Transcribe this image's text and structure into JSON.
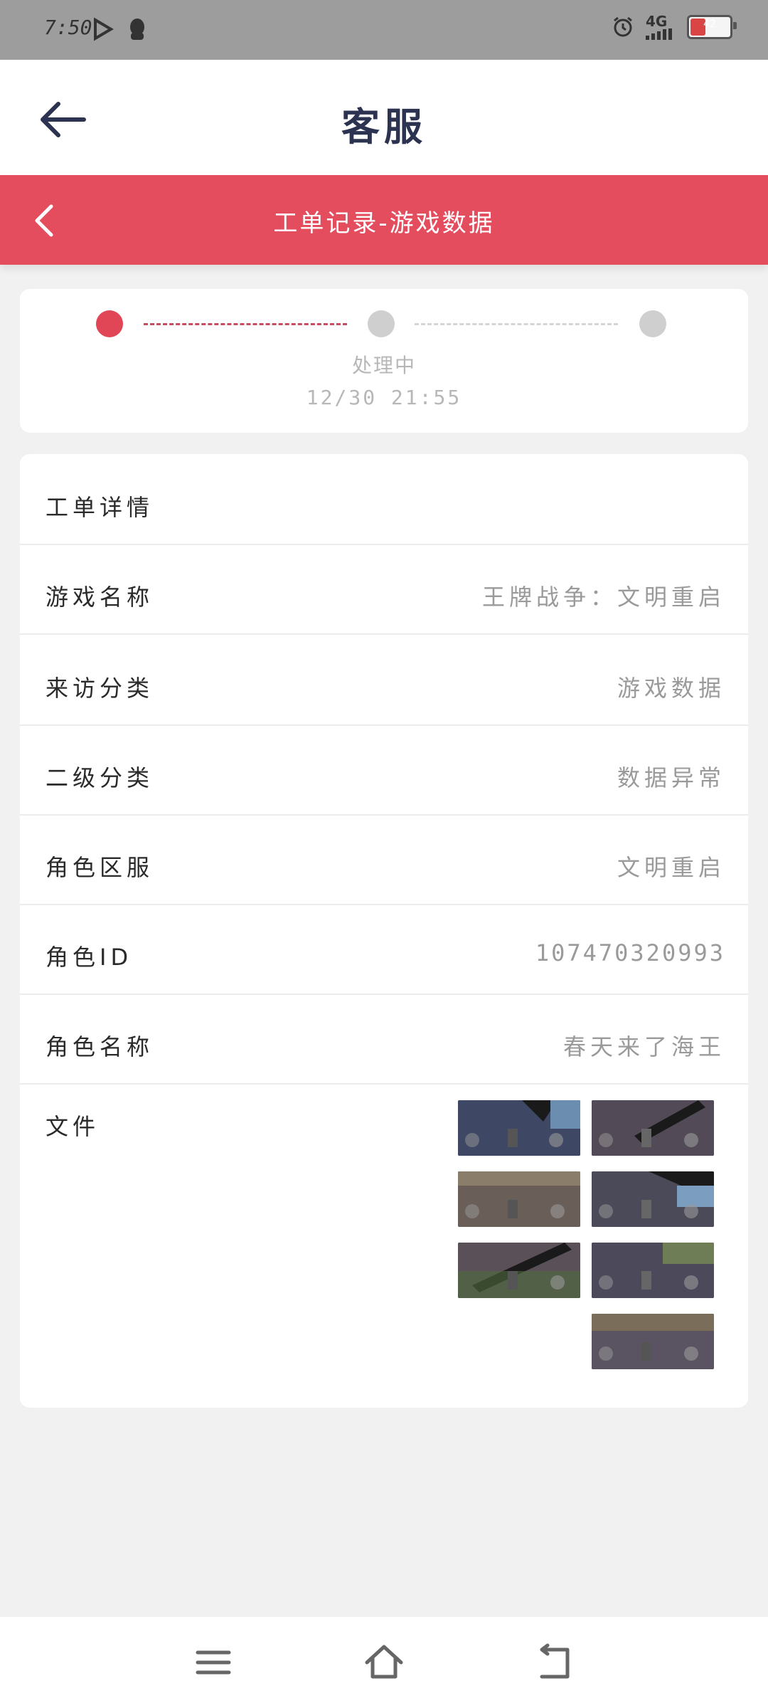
{
  "status_bar": {
    "time": "7:50",
    "network": "4G",
    "battery": "42",
    "battery_level_pct": 42
  },
  "app_header": {
    "title": "客服"
  },
  "banner": {
    "title": "工单记录-游戏数据"
  },
  "progress": {
    "current_step_label": "处理中",
    "current_step_time": "12/30 21:55",
    "steps_count": 3,
    "active_index": 0
  },
  "details": {
    "header": "工单详情",
    "rows": [
      {
        "label": "游戏名称",
        "value": "王牌战争：文明重启"
      },
      {
        "label": "来访分类",
        "value": "游戏数据"
      },
      {
        "label": "二级分类",
        "value": "数据异常"
      },
      {
        "label": "角色区服",
        "value": "文明重启"
      },
      {
        "label": "角色ID",
        "value": "107470320993"
      },
      {
        "label": "角色名称",
        "value": "春天来了海王"
      }
    ],
    "files_label": "文件",
    "files_count": 7
  },
  "colors": {
    "accent": "#e44d5e",
    "title_dark": "#2c3350"
  },
  "navbar": {
    "icons": [
      "menu-icon",
      "home-icon",
      "back-icon"
    ]
  }
}
